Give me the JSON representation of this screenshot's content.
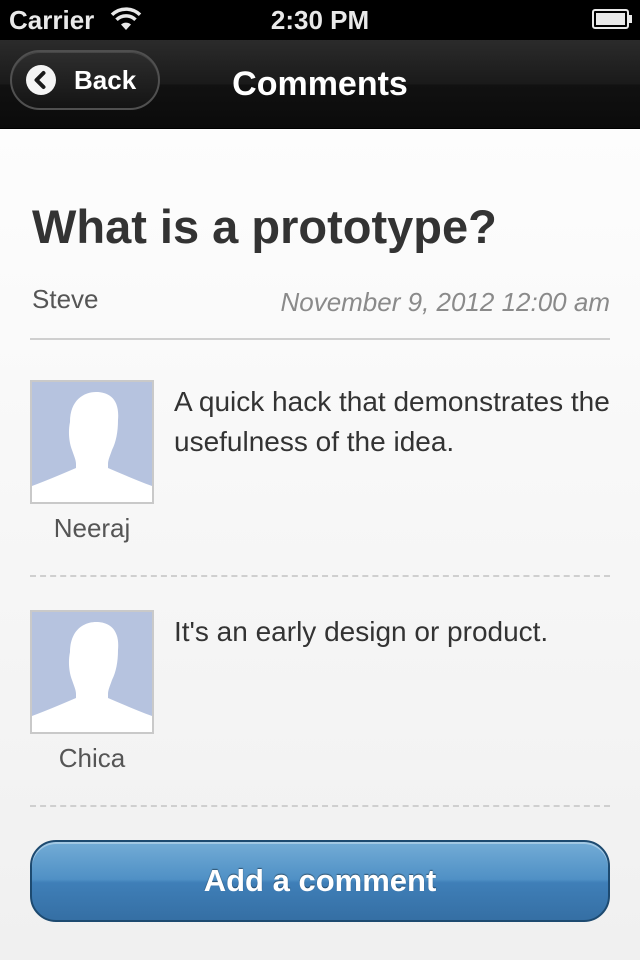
{
  "status_bar": {
    "carrier": "Carrier",
    "time": "2:30 PM",
    "icons": [
      "wifi-icon",
      "battery-icon"
    ]
  },
  "nav": {
    "back_label": "Back",
    "title": "Comments"
  },
  "post": {
    "title": "What is a prototype?",
    "author": "Steve",
    "date": "November 9, 2012 12:00 am"
  },
  "comments": [
    {
      "author": "Neeraj",
      "text": "A quick hack that demonstrates the usefulness of the idea.",
      "avatar_icon": "default-avatar-icon"
    },
    {
      "author": "Chica",
      "text": "It's an early design or product.",
      "avatar_icon": "default-avatar-icon"
    }
  ],
  "actions": {
    "add_comment_label": "Add a comment"
  },
  "colors": {
    "nav_background": "#111111",
    "button_blue": "#4f90c5",
    "avatar_background": "#b6c3df",
    "divider": "#cfcfcf"
  }
}
